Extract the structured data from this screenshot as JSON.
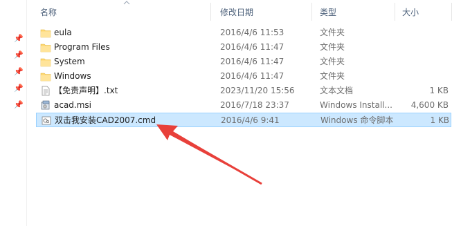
{
  "columns": {
    "name": "名称",
    "date": "修改日期",
    "type": "类型",
    "size": "大小"
  },
  "files": [
    {
      "name": "eula",
      "date": "2016/4/6 11:53",
      "type": "文件夹",
      "size": "",
      "icon": "folder-icon"
    },
    {
      "name": "Program Files",
      "date": "2016/4/6 11:47",
      "type": "文件夹",
      "size": "",
      "icon": "folder-icon"
    },
    {
      "name": "System",
      "date": "2016/4/6 11:47",
      "type": "文件夹",
      "size": "",
      "icon": "folder-icon"
    },
    {
      "name": "Windows",
      "date": "2016/4/6 11:47",
      "type": "文件夹",
      "size": "",
      "icon": "folder-icon"
    },
    {
      "name": "【免责声明】.txt",
      "date": "2023/11/20 15:56",
      "type": "文本文档",
      "size": "1 KB",
      "icon": "text-file-icon"
    },
    {
      "name": "acad.msi",
      "date": "2016/7/18 23:37",
      "type": "Windows Install...",
      "size": "4,600 KB",
      "icon": "installer-icon"
    },
    {
      "name": "双击我安装CAD2007.cmd",
      "date": "2016/4/6 9:41",
      "type": "Windows 命令脚本",
      "size": "1 KB",
      "icon": "cmd-file-icon",
      "selected": true
    }
  ],
  "colors": {
    "selection_bg": "#cce8ff",
    "selection_border": "#99d1ff",
    "header_text": "#4c607a",
    "folder": "#ffd870",
    "annotation_arrow": "#e8403a"
  }
}
